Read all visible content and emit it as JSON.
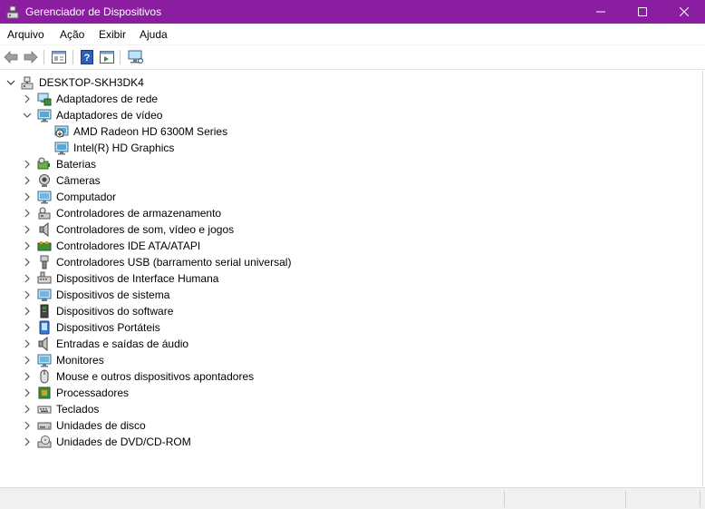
{
  "window": {
    "title": "Gerenciador de Dispositivos",
    "icon": "device-manager-icon"
  },
  "menu": [
    "Arquivo",
    "Ação",
    "Exibir",
    "Ajuda"
  ],
  "toolbar": {
    "buttons": [
      "back-arrow-icon",
      "forward-arrow-icon",
      "properties-icon",
      "help-icon",
      "run-icon",
      "scan-hardware-icon"
    ]
  },
  "tree": {
    "root": "DESKTOP-SKH3DK4",
    "nodes": [
      {
        "label": "Adaptadores de rede",
        "icon": "network-adapter-icon",
        "expanded": false
      },
      {
        "label": "Adaptadores de vídeo",
        "icon": "display-adapter-icon",
        "expanded": true,
        "children": [
          {
            "label": "AMD Radeon HD 6300M Series",
            "icon": "display-adapter-warning-icon"
          },
          {
            "label": "Intel(R) HD Graphics",
            "icon": "display-adapter-icon"
          }
        ]
      },
      {
        "label": "Baterias",
        "icon": "battery-icon",
        "expanded": false
      },
      {
        "label": "Câmeras",
        "icon": "camera-icon",
        "expanded": false
      },
      {
        "label": "Computador",
        "icon": "computer-icon",
        "expanded": false
      },
      {
        "label": "Controladores de armazenamento",
        "icon": "storage-controller-icon",
        "expanded": false
      },
      {
        "label": "Controladores de som, vídeo e jogos",
        "icon": "sound-controller-icon",
        "expanded": false
      },
      {
        "label": "Controladores IDE ATA/ATAPI",
        "icon": "ide-controller-icon",
        "expanded": false
      },
      {
        "label": "Controladores USB (barramento serial universal)",
        "icon": "usb-controller-icon",
        "expanded": false
      },
      {
        "label": "Dispositivos de Interface Humana",
        "icon": "hid-icon",
        "expanded": false
      },
      {
        "label": "Dispositivos de sistema",
        "icon": "system-device-icon",
        "expanded": false
      },
      {
        "label": "Dispositivos do software",
        "icon": "software-device-icon",
        "expanded": false
      },
      {
        "label": "Dispositivos Portáteis",
        "icon": "portable-device-icon",
        "expanded": false
      },
      {
        "label": "Entradas e saídas de áudio",
        "icon": "audio-io-icon",
        "expanded": false
      },
      {
        "label": "Monitores",
        "icon": "monitor-icon",
        "expanded": false
      },
      {
        "label": "Mouse e outros dispositivos apontadores",
        "icon": "mouse-icon",
        "expanded": false
      },
      {
        "label": "Processadores",
        "icon": "processor-icon",
        "expanded": false
      },
      {
        "label": "Teclados",
        "icon": "keyboard-icon",
        "expanded": false
      },
      {
        "label": "Unidades de disco",
        "icon": "disk-drive-icon",
        "expanded": false
      },
      {
        "label": "Unidades de DVD/CD-ROM",
        "icon": "dvd-drive-icon",
        "expanded": false
      }
    ]
  }
}
